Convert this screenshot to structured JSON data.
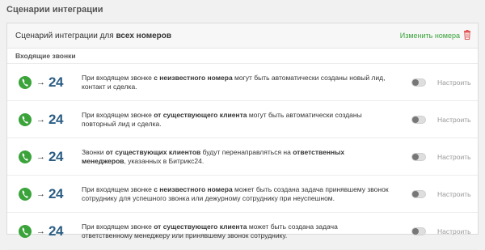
{
  "section_title": "Сценарии интеграции",
  "header": {
    "prefix": "Сценарий интеграции для",
    "bold": "всех номеров",
    "change_link": "Изменить номера"
  },
  "incoming_title": "Входящие звонки",
  "logo_text": "24",
  "arrow": "→",
  "setup_label": "Настроить",
  "rows": [
    {
      "p1": "При входящем звонке ",
      "b1": "с неизвестного номера",
      "p2": " могут быть автоматически созданы новый лид, контакт и сделка.",
      "b2": "",
      "p3": ""
    },
    {
      "p1": "При входящем звонке ",
      "b1": "от существующего клиента",
      "p2": " могут быть автоматически созданы повторный лид и сделка.",
      "b2": "",
      "p3": ""
    },
    {
      "p1": "Звонки ",
      "b1": "от существующих клиентов",
      "p2": " будут перенаправляться на ",
      "b2": "ответственных менеджеров",
      "p3": ", указанных в Битрикс24."
    },
    {
      "p1": "При входящем звонке ",
      "b1": "с неизвестного номера",
      "p2": " может быть создана задача принявшему звонок сотруднику для успешного звонка или дежурному сотруднику при неуспешном.",
      "b2": "",
      "p3": ""
    },
    {
      "p1": "При входящем звонке ",
      "b1": "от существующего клиента",
      "p2": " может быть создана задача ответственному менеджеру или принявшему звонок сотруднику.",
      "b2": "",
      "p3": ""
    }
  ],
  "colors": {
    "link": "#3aa33a",
    "logo_blue": "#2b5d84",
    "phone_green": "#3aa33a",
    "trash_red": "#e05050"
  }
}
